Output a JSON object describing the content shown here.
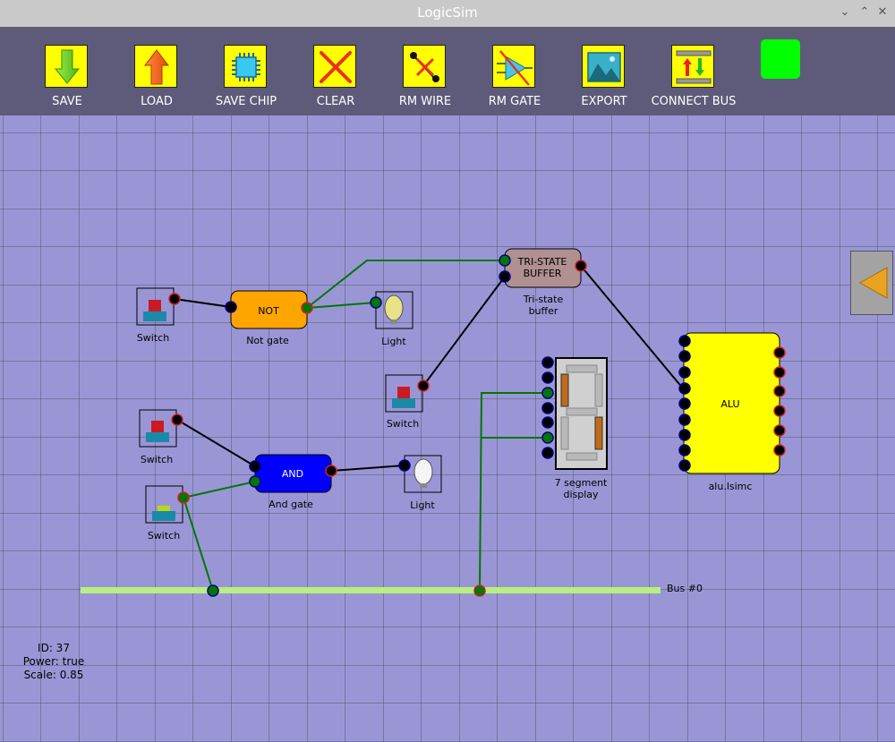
{
  "window": {
    "title": "LogicSim"
  },
  "toolbar": {
    "items": [
      {
        "label": "SAVE",
        "icon": "down-arrow-icon"
      },
      {
        "label": "LOAD",
        "icon": "up-arrow-icon"
      },
      {
        "label": "SAVE CHIP",
        "icon": "chip-icon"
      },
      {
        "label": "CLEAR",
        "icon": "x-icon"
      },
      {
        "label": "RM WIRE",
        "icon": "remove-wire-icon"
      },
      {
        "label": "RM GATE",
        "icon": "remove-gate-icon"
      },
      {
        "label": "EXPORT",
        "icon": "image-icon"
      },
      {
        "label": "CONNECT BUS",
        "icon": "bus-icon"
      }
    ],
    "status_color": "#00ff00"
  },
  "components": {
    "switch1": "Switch",
    "switch2": "Switch",
    "switch3": "Switch",
    "switch4": "Switch",
    "not_gate": {
      "text": "NOT",
      "label": "Not gate"
    },
    "and_gate": {
      "text": "AND",
      "label": "And gate"
    },
    "light1": "Light",
    "light2": "Light",
    "tristate": {
      "text_line1": "TRI-STATE",
      "text_line2": "BUFFER",
      "label_line1": "Tri-state",
      "label_line2": "buffer"
    },
    "seven_seg": {
      "label_line1": "7 segment",
      "label_line2": "display"
    },
    "alu": {
      "text": "ALU",
      "label": "alu.lsimc"
    },
    "bus": {
      "label": "Bus #0"
    }
  },
  "info": {
    "id": "ID: 37",
    "power": "Power: true",
    "scale": "Scale: 0.85"
  },
  "colors": {
    "canvas": "#9a96d6",
    "grid": "#4a5a6a",
    "not_gate": "#ffa500",
    "and_gate": "#0000ff",
    "tristate": "#b09090",
    "alu": "#ffff00",
    "wire_on": "#007700",
    "wire_off": "#000000",
    "bus": "#b8ef80"
  }
}
